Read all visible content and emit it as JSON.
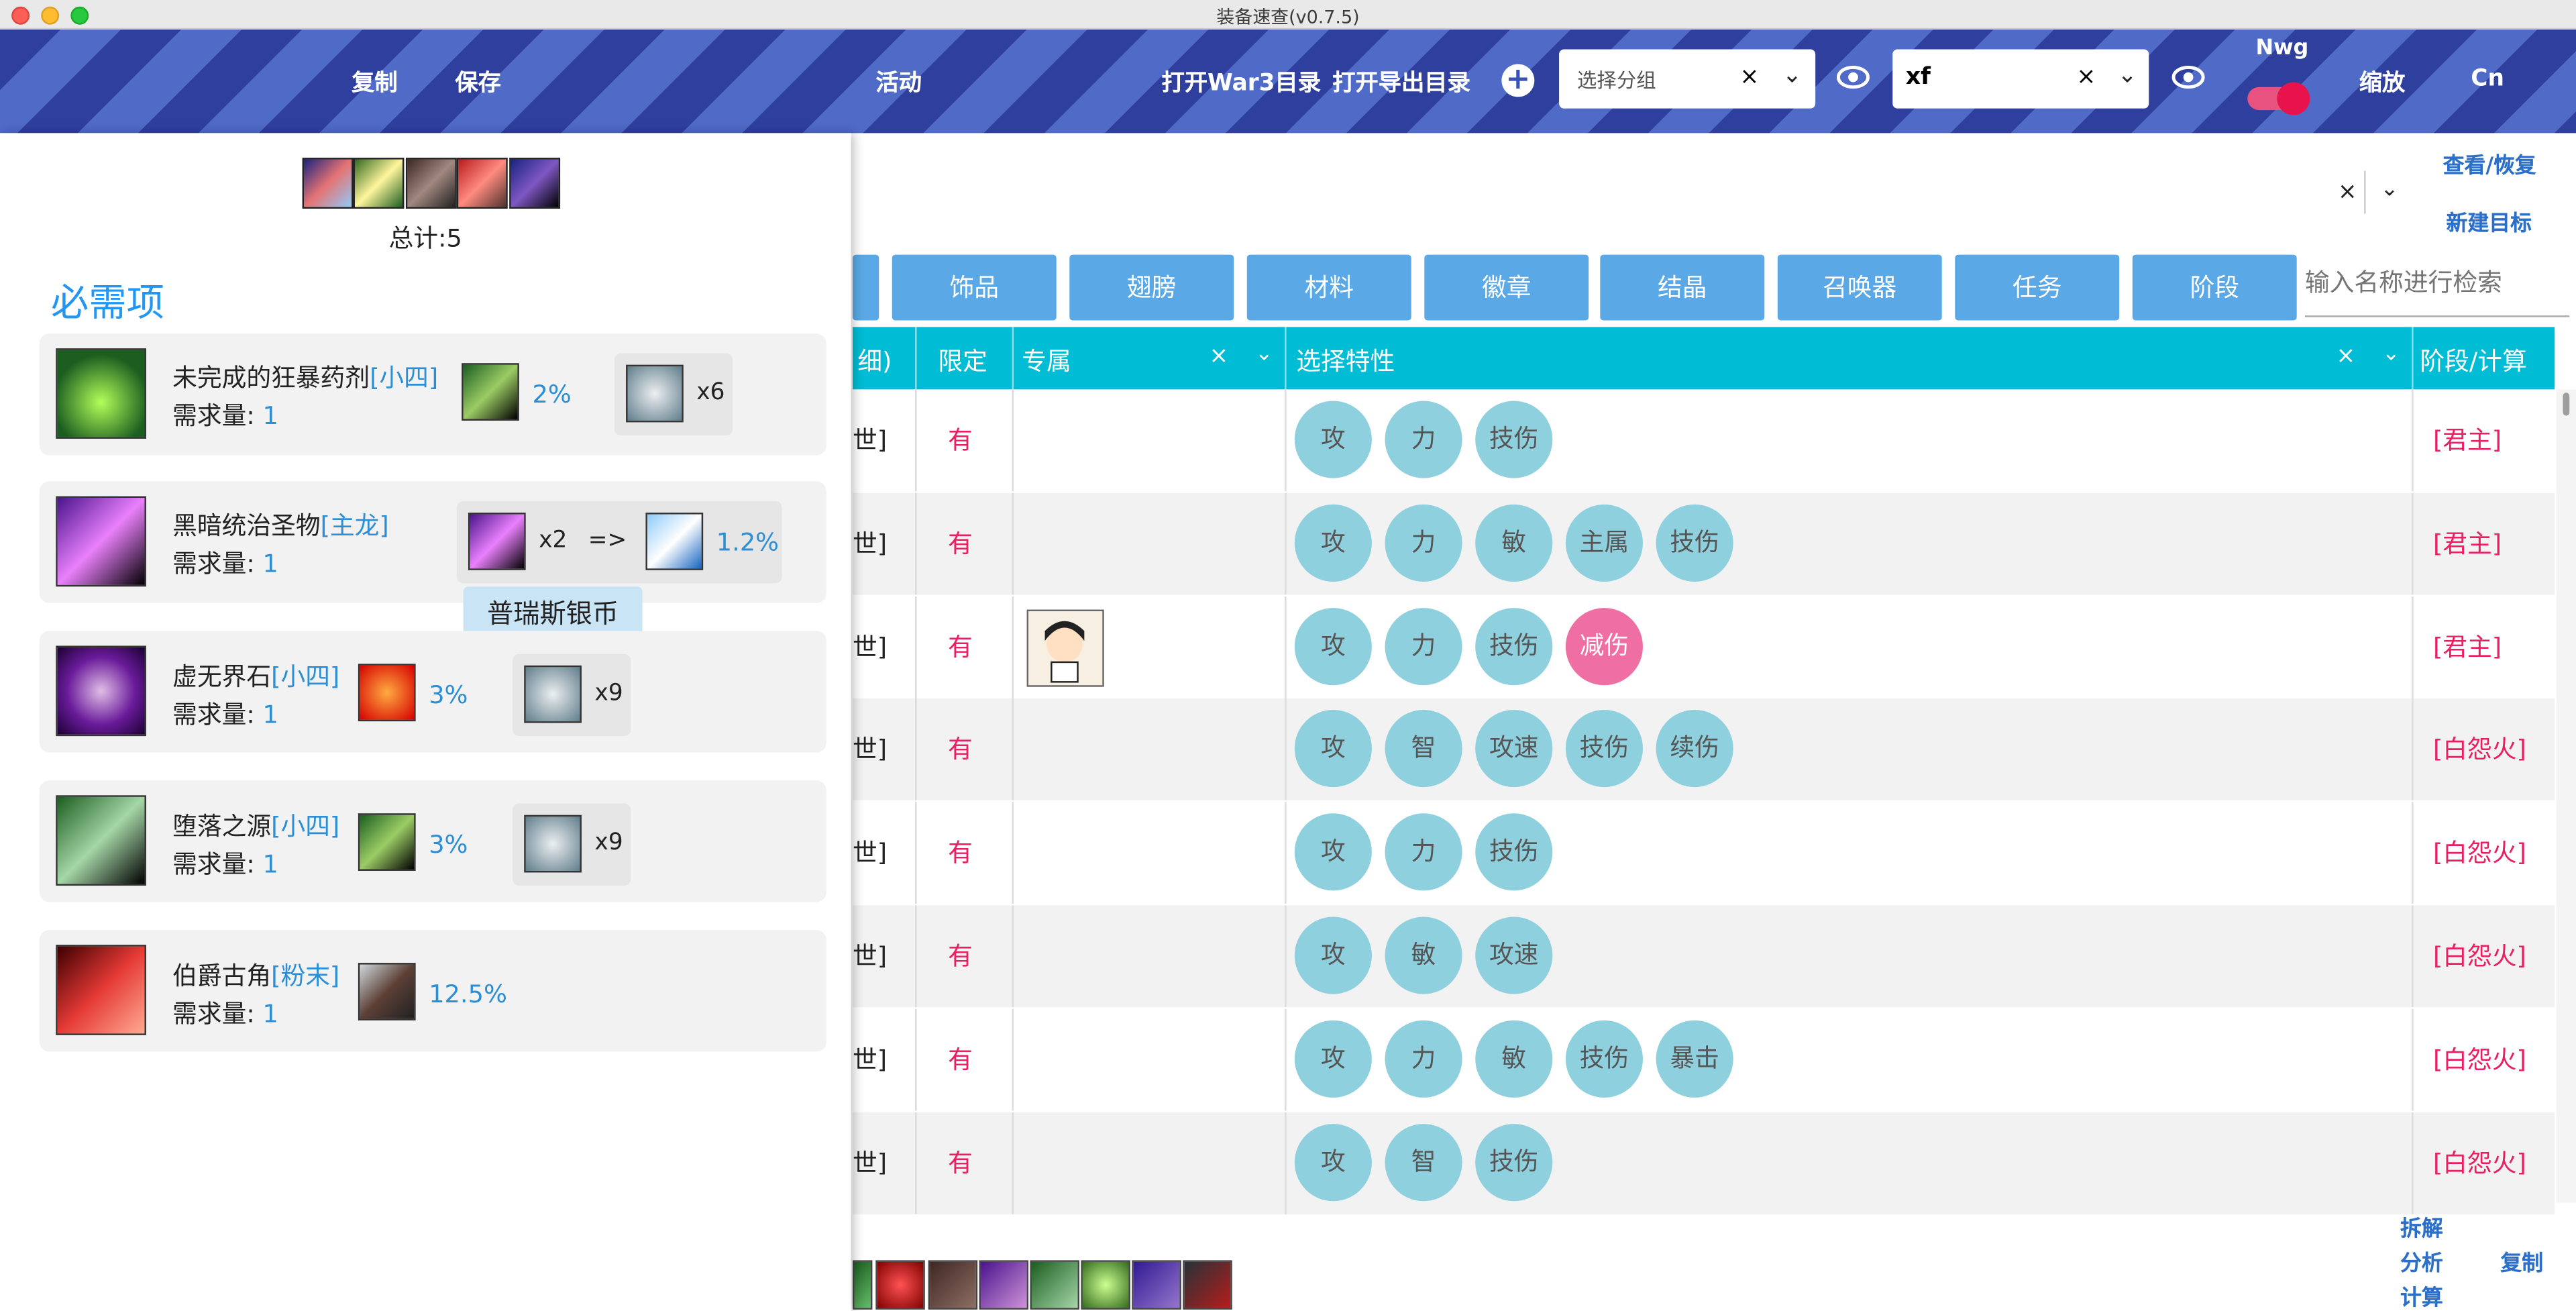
{
  "window": {
    "title": "装备速查(v0.7.5)"
  },
  "toolbar": {
    "copy_label": "复制",
    "save_label": "保存",
    "activity_label": "活动",
    "open_war3_label": "打开War3目录",
    "open_export_label": "打开导出目录",
    "add_label": "+",
    "group_select": {
      "placeholder": "选择分组",
      "clear": "×",
      "chevron": "⌄"
    },
    "search_select": {
      "value": "xf",
      "clear": "×",
      "chevron": "⌄"
    },
    "toggle_label": "Nwg",
    "zoom_label": "缩放",
    "lang_label": "Cn"
  },
  "side_links": {
    "view_restore": "查看/恢复",
    "new_target": "新建目标",
    "clear": "×",
    "chevron": "⌄"
  },
  "categories": [
    "饰品",
    "翅膀",
    "材料",
    "徽章",
    "结晶",
    "召唤器",
    "任务",
    "阶段"
  ],
  "search": {
    "placeholder": "输入名称进行检索"
  },
  "table": {
    "headers": {
      "partial": "细)",
      "limited": "限定",
      "exclusive": "专属",
      "traits": "选择特性",
      "stage": "阶段/计算"
    },
    "clear": "×",
    "chevron": "⌄",
    "rows": [
      {
        "c1": "世]",
        "limited": "有",
        "traits": [
          "攻",
          "力",
          "技伤"
        ],
        "stage": "[君主]"
      },
      {
        "c1": "世]",
        "limited": "有",
        "traits": [
          "攻",
          "力",
          "敏",
          "主属",
          "技伤"
        ],
        "stage": "[君主]"
      },
      {
        "c1": "世]",
        "limited": "有",
        "traits": [
          "攻",
          "力",
          "技伤",
          "减伤"
        ],
        "stage": "[君主]"
      },
      {
        "c1": "世]",
        "limited": "有",
        "traits": [
          "攻",
          "智",
          "攻速",
          "技伤",
          "续伤"
        ],
        "stage": "[白怨火]"
      },
      {
        "c1": "世]",
        "limited": "有",
        "traits": [
          "攻",
          "力",
          "技伤"
        ],
        "stage": "[白怨火]"
      },
      {
        "c1": "世]",
        "limited": "有",
        "traits": [
          "攻",
          "敏",
          "攻速"
        ],
        "stage": "[白怨火]"
      },
      {
        "c1": "世]",
        "limited": "有",
        "traits": [
          "攻",
          "力",
          "敏",
          "技伤",
          "暴击"
        ],
        "stage": "[白怨火]"
      },
      {
        "c1": "世]",
        "limited": "有",
        "traits": [
          "攻",
          "智",
          "技伤"
        ],
        "stage": "[白怨火]"
      }
    ]
  },
  "bottom_links": {
    "dismantle": "拆解",
    "analyze": "分析",
    "calculate": "计算",
    "copy": "复制"
  },
  "panel": {
    "total": "总计:5",
    "required_title": "必需项",
    "qty_label": "需求量:",
    "tooltip": "普瑞斯银币",
    "items": [
      {
        "name": "未完成的狂暴药剂",
        "tag": "[小四]",
        "qty": "1",
        "pct": "2%",
        "mult": "x6"
      },
      {
        "name": "黑暗统治圣物",
        "tag": "[主龙]",
        "qty": "1",
        "mult": "x2",
        "arrow": "=>",
        "pct": "1.2%"
      },
      {
        "name": "虚无界石",
        "tag": "[小四]",
        "qty": "1",
        "pct": "3%",
        "mult": "x9"
      },
      {
        "name": "堕落之源",
        "tag": "[小四]",
        "qty": "1",
        "pct": "3%",
        "mult": "x9"
      },
      {
        "name": "伯爵古角",
        "tag": "[粉末]",
        "qty": "1",
        "pct": "12.5%"
      }
    ]
  }
}
